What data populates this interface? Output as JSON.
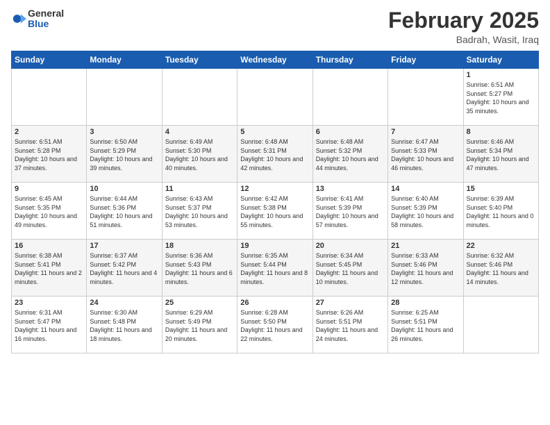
{
  "header": {
    "logo_general": "General",
    "logo_blue": "Blue",
    "month_title": "February 2025",
    "location": "Badrah, Wasit, Iraq"
  },
  "days_of_week": [
    "Sunday",
    "Monday",
    "Tuesday",
    "Wednesday",
    "Thursday",
    "Friday",
    "Saturday"
  ],
  "weeks": [
    [
      {
        "day": "",
        "info": ""
      },
      {
        "day": "",
        "info": ""
      },
      {
        "day": "",
        "info": ""
      },
      {
        "day": "",
        "info": ""
      },
      {
        "day": "",
        "info": ""
      },
      {
        "day": "",
        "info": ""
      },
      {
        "day": "1",
        "info": "Sunrise: 6:51 AM\nSunset: 5:27 PM\nDaylight: 10 hours and 35 minutes."
      }
    ],
    [
      {
        "day": "2",
        "info": "Sunrise: 6:51 AM\nSunset: 5:28 PM\nDaylight: 10 hours and 37 minutes."
      },
      {
        "day": "3",
        "info": "Sunrise: 6:50 AM\nSunset: 5:29 PM\nDaylight: 10 hours and 39 minutes."
      },
      {
        "day": "4",
        "info": "Sunrise: 6:49 AM\nSunset: 5:30 PM\nDaylight: 10 hours and 40 minutes."
      },
      {
        "day": "5",
        "info": "Sunrise: 6:48 AM\nSunset: 5:31 PM\nDaylight: 10 hours and 42 minutes."
      },
      {
        "day": "6",
        "info": "Sunrise: 6:48 AM\nSunset: 5:32 PM\nDaylight: 10 hours and 44 minutes."
      },
      {
        "day": "7",
        "info": "Sunrise: 6:47 AM\nSunset: 5:33 PM\nDaylight: 10 hours and 46 minutes."
      },
      {
        "day": "8",
        "info": "Sunrise: 6:46 AM\nSunset: 5:34 PM\nDaylight: 10 hours and 47 minutes."
      }
    ],
    [
      {
        "day": "9",
        "info": "Sunrise: 6:45 AM\nSunset: 5:35 PM\nDaylight: 10 hours and 49 minutes."
      },
      {
        "day": "10",
        "info": "Sunrise: 6:44 AM\nSunset: 5:36 PM\nDaylight: 10 hours and 51 minutes."
      },
      {
        "day": "11",
        "info": "Sunrise: 6:43 AM\nSunset: 5:37 PM\nDaylight: 10 hours and 53 minutes."
      },
      {
        "day": "12",
        "info": "Sunrise: 6:42 AM\nSunset: 5:38 PM\nDaylight: 10 hours and 55 minutes."
      },
      {
        "day": "13",
        "info": "Sunrise: 6:41 AM\nSunset: 5:39 PM\nDaylight: 10 hours and 57 minutes."
      },
      {
        "day": "14",
        "info": "Sunrise: 6:40 AM\nSunset: 5:39 PM\nDaylight: 10 hours and 58 minutes."
      },
      {
        "day": "15",
        "info": "Sunrise: 6:39 AM\nSunset: 5:40 PM\nDaylight: 11 hours and 0 minutes."
      }
    ],
    [
      {
        "day": "16",
        "info": "Sunrise: 6:38 AM\nSunset: 5:41 PM\nDaylight: 11 hours and 2 minutes."
      },
      {
        "day": "17",
        "info": "Sunrise: 6:37 AM\nSunset: 5:42 PM\nDaylight: 11 hours and 4 minutes."
      },
      {
        "day": "18",
        "info": "Sunrise: 6:36 AM\nSunset: 5:43 PM\nDaylight: 11 hours and 6 minutes."
      },
      {
        "day": "19",
        "info": "Sunrise: 6:35 AM\nSunset: 5:44 PM\nDaylight: 11 hours and 8 minutes."
      },
      {
        "day": "20",
        "info": "Sunrise: 6:34 AM\nSunset: 5:45 PM\nDaylight: 11 hours and 10 minutes."
      },
      {
        "day": "21",
        "info": "Sunrise: 6:33 AM\nSunset: 5:46 PM\nDaylight: 11 hours and 12 minutes."
      },
      {
        "day": "22",
        "info": "Sunrise: 6:32 AM\nSunset: 5:46 PM\nDaylight: 11 hours and 14 minutes."
      }
    ],
    [
      {
        "day": "23",
        "info": "Sunrise: 6:31 AM\nSunset: 5:47 PM\nDaylight: 11 hours and 16 minutes."
      },
      {
        "day": "24",
        "info": "Sunrise: 6:30 AM\nSunset: 5:48 PM\nDaylight: 11 hours and 18 minutes."
      },
      {
        "day": "25",
        "info": "Sunrise: 6:29 AM\nSunset: 5:49 PM\nDaylight: 11 hours and 20 minutes."
      },
      {
        "day": "26",
        "info": "Sunrise: 6:28 AM\nSunset: 5:50 PM\nDaylight: 11 hours and 22 minutes."
      },
      {
        "day": "27",
        "info": "Sunrise: 6:26 AM\nSunset: 5:51 PM\nDaylight: 11 hours and 24 minutes."
      },
      {
        "day": "28",
        "info": "Sunrise: 6:25 AM\nSunset: 5:51 PM\nDaylight: 11 hours and 26 minutes."
      },
      {
        "day": "",
        "info": ""
      }
    ]
  ]
}
